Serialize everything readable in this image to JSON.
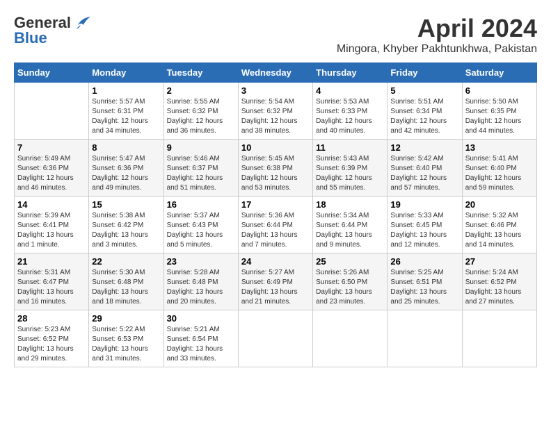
{
  "header": {
    "logo_general": "General",
    "logo_blue": "Blue",
    "month": "April 2024",
    "location": "Mingora, Khyber Pakhtunkhwa, Pakistan"
  },
  "days_of_week": [
    "Sunday",
    "Monday",
    "Tuesday",
    "Wednesday",
    "Thursday",
    "Friday",
    "Saturday"
  ],
  "weeks": [
    [
      {
        "day": "",
        "sunrise": "",
        "sunset": "",
        "daylight": ""
      },
      {
        "day": "1",
        "sunrise": "Sunrise: 5:57 AM",
        "sunset": "Sunset: 6:31 PM",
        "daylight": "Daylight: 12 hours and 34 minutes."
      },
      {
        "day": "2",
        "sunrise": "Sunrise: 5:55 AM",
        "sunset": "Sunset: 6:32 PM",
        "daylight": "Daylight: 12 hours and 36 minutes."
      },
      {
        "day": "3",
        "sunrise": "Sunrise: 5:54 AM",
        "sunset": "Sunset: 6:32 PM",
        "daylight": "Daylight: 12 hours and 38 minutes."
      },
      {
        "day": "4",
        "sunrise": "Sunrise: 5:53 AM",
        "sunset": "Sunset: 6:33 PM",
        "daylight": "Daylight: 12 hours and 40 minutes."
      },
      {
        "day": "5",
        "sunrise": "Sunrise: 5:51 AM",
        "sunset": "Sunset: 6:34 PM",
        "daylight": "Daylight: 12 hours and 42 minutes."
      },
      {
        "day": "6",
        "sunrise": "Sunrise: 5:50 AM",
        "sunset": "Sunset: 6:35 PM",
        "daylight": "Daylight: 12 hours and 44 minutes."
      }
    ],
    [
      {
        "day": "7",
        "sunrise": "Sunrise: 5:49 AM",
        "sunset": "Sunset: 6:36 PM",
        "daylight": "Daylight: 12 hours and 46 minutes."
      },
      {
        "day": "8",
        "sunrise": "Sunrise: 5:47 AM",
        "sunset": "Sunset: 6:36 PM",
        "daylight": "Daylight: 12 hours and 49 minutes."
      },
      {
        "day": "9",
        "sunrise": "Sunrise: 5:46 AM",
        "sunset": "Sunset: 6:37 PM",
        "daylight": "Daylight: 12 hours and 51 minutes."
      },
      {
        "day": "10",
        "sunrise": "Sunrise: 5:45 AM",
        "sunset": "Sunset: 6:38 PM",
        "daylight": "Daylight: 12 hours and 53 minutes."
      },
      {
        "day": "11",
        "sunrise": "Sunrise: 5:43 AM",
        "sunset": "Sunset: 6:39 PM",
        "daylight": "Daylight: 12 hours and 55 minutes."
      },
      {
        "day": "12",
        "sunrise": "Sunrise: 5:42 AM",
        "sunset": "Sunset: 6:40 PM",
        "daylight": "Daylight: 12 hours and 57 minutes."
      },
      {
        "day": "13",
        "sunrise": "Sunrise: 5:41 AM",
        "sunset": "Sunset: 6:40 PM",
        "daylight": "Daylight: 12 hours and 59 minutes."
      }
    ],
    [
      {
        "day": "14",
        "sunrise": "Sunrise: 5:39 AM",
        "sunset": "Sunset: 6:41 PM",
        "daylight": "Daylight: 13 hours and 1 minute."
      },
      {
        "day": "15",
        "sunrise": "Sunrise: 5:38 AM",
        "sunset": "Sunset: 6:42 PM",
        "daylight": "Daylight: 13 hours and 3 minutes."
      },
      {
        "day": "16",
        "sunrise": "Sunrise: 5:37 AM",
        "sunset": "Sunset: 6:43 PM",
        "daylight": "Daylight: 13 hours and 5 minutes."
      },
      {
        "day": "17",
        "sunrise": "Sunrise: 5:36 AM",
        "sunset": "Sunset: 6:44 PM",
        "daylight": "Daylight: 13 hours and 7 minutes."
      },
      {
        "day": "18",
        "sunrise": "Sunrise: 5:34 AM",
        "sunset": "Sunset: 6:44 PM",
        "daylight": "Daylight: 13 hours and 9 minutes."
      },
      {
        "day": "19",
        "sunrise": "Sunrise: 5:33 AM",
        "sunset": "Sunset: 6:45 PM",
        "daylight": "Daylight: 13 hours and 12 minutes."
      },
      {
        "day": "20",
        "sunrise": "Sunrise: 5:32 AM",
        "sunset": "Sunset: 6:46 PM",
        "daylight": "Daylight: 13 hours and 14 minutes."
      }
    ],
    [
      {
        "day": "21",
        "sunrise": "Sunrise: 5:31 AM",
        "sunset": "Sunset: 6:47 PM",
        "daylight": "Daylight: 13 hours and 16 minutes."
      },
      {
        "day": "22",
        "sunrise": "Sunrise: 5:30 AM",
        "sunset": "Sunset: 6:48 PM",
        "daylight": "Daylight: 13 hours and 18 minutes."
      },
      {
        "day": "23",
        "sunrise": "Sunrise: 5:28 AM",
        "sunset": "Sunset: 6:48 PM",
        "daylight": "Daylight: 13 hours and 20 minutes."
      },
      {
        "day": "24",
        "sunrise": "Sunrise: 5:27 AM",
        "sunset": "Sunset: 6:49 PM",
        "daylight": "Daylight: 13 hours and 21 minutes."
      },
      {
        "day": "25",
        "sunrise": "Sunrise: 5:26 AM",
        "sunset": "Sunset: 6:50 PM",
        "daylight": "Daylight: 13 hours and 23 minutes."
      },
      {
        "day": "26",
        "sunrise": "Sunrise: 5:25 AM",
        "sunset": "Sunset: 6:51 PM",
        "daylight": "Daylight: 13 hours and 25 minutes."
      },
      {
        "day": "27",
        "sunrise": "Sunrise: 5:24 AM",
        "sunset": "Sunset: 6:52 PM",
        "daylight": "Daylight: 13 hours and 27 minutes."
      }
    ],
    [
      {
        "day": "28",
        "sunrise": "Sunrise: 5:23 AM",
        "sunset": "Sunset: 6:52 PM",
        "daylight": "Daylight: 13 hours and 29 minutes."
      },
      {
        "day": "29",
        "sunrise": "Sunrise: 5:22 AM",
        "sunset": "Sunset: 6:53 PM",
        "daylight": "Daylight: 13 hours and 31 minutes."
      },
      {
        "day": "30",
        "sunrise": "Sunrise: 5:21 AM",
        "sunset": "Sunset: 6:54 PM",
        "daylight": "Daylight: 13 hours and 33 minutes."
      },
      {
        "day": "",
        "sunrise": "",
        "sunset": "",
        "daylight": ""
      },
      {
        "day": "",
        "sunrise": "",
        "sunset": "",
        "daylight": ""
      },
      {
        "day": "",
        "sunrise": "",
        "sunset": "",
        "daylight": ""
      },
      {
        "day": "",
        "sunrise": "",
        "sunset": "",
        "daylight": ""
      }
    ]
  ]
}
